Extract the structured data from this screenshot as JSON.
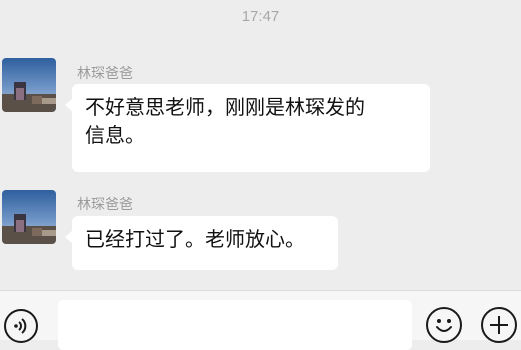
{
  "chat": {
    "timestamp": "17:47",
    "messages": [
      {
        "sender": "林琛爸爸",
        "text": "不好意思老师，刚刚是林琛发的\n信息。"
      },
      {
        "sender": "林琛爸爸",
        "text": "已经打过了。老师放心。"
      }
    ]
  },
  "icons": {
    "voice": "voice-icon",
    "emoji": "emoji-icon",
    "plus": "plus-icon"
  },
  "colors": {
    "chat_background": "#ededed",
    "bubble": "#ffffff",
    "input_bar": "#f6f6f6"
  }
}
